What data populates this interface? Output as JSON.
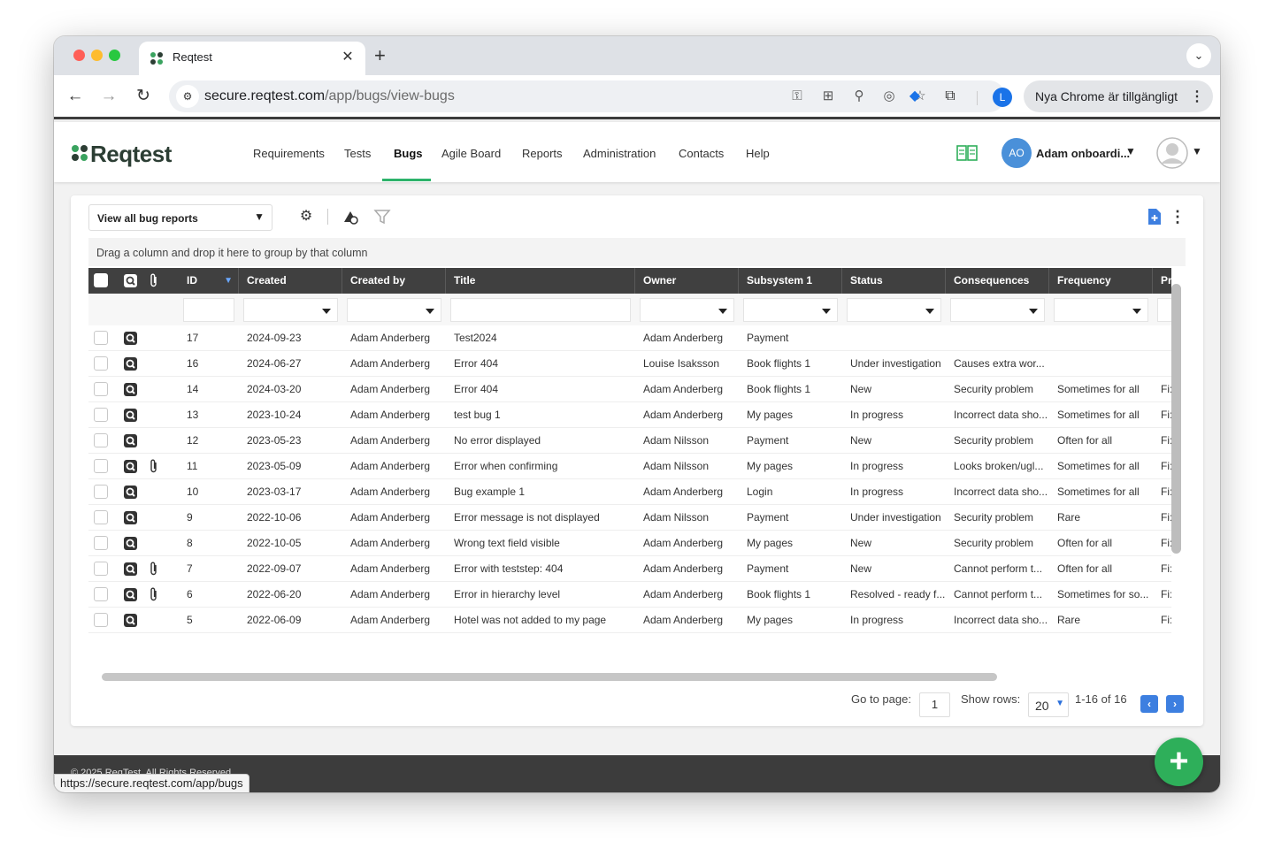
{
  "browser": {
    "tab_title": "Reqtest",
    "tab_close": "✕",
    "new_tab": "+",
    "url_host": "secure.reqtest.com",
    "url_path": "/app/bugs/view-bugs",
    "profile_initial": "L",
    "update_text": "Nya Chrome är tillgängligt"
  },
  "app": {
    "logo_text": "Reqtest",
    "nav": [
      "Requirements",
      "Tests",
      "Bugs",
      "Agile Board",
      "Reports",
      "Administration",
      "Contacts",
      "Help"
    ],
    "active_nav": "Bugs",
    "user_initials": "AO",
    "user_name": "Adam onboardi..."
  },
  "toolbar": {
    "view_select": "View all bug reports",
    "group_hint": "Drag a column and drop it here to group by that column"
  },
  "table": {
    "columns": [
      "ID",
      "Created",
      "Created by",
      "Title",
      "Owner",
      "Subsystem 1",
      "Status",
      "Consequences",
      "Frequency",
      "Pr"
    ],
    "rows": [
      {
        "attach": false,
        "id": "17",
        "created": "2024-09-23",
        "created_by": "Adam Anderberg",
        "title": "Test2024",
        "owner": "Adam Anderberg",
        "subsystem": "Payment",
        "status": "",
        "consequences": "",
        "frequency": "",
        "pr": ""
      },
      {
        "attach": false,
        "id": "16",
        "created": "2024-06-27",
        "created_by": "Adam Anderberg",
        "title": "Error 404",
        "owner": "Louise Isaksson",
        "subsystem": "Book flights 1",
        "status": "Under investigation",
        "consequences": "Causes extra wor...",
        "frequency": "",
        "pr": ""
      },
      {
        "attach": false,
        "id": "14",
        "created": "2024-03-20",
        "created_by": "Adam Anderberg",
        "title": "Error 404",
        "owner": "Adam Anderberg",
        "subsystem": "Book flights 1",
        "status": "New",
        "consequences": "Security problem",
        "frequency": "Sometimes for all",
        "pr": "Fi:"
      },
      {
        "attach": false,
        "id": "13",
        "created": "2023-10-24",
        "created_by": "Adam Anderberg",
        "title": "test bug 1",
        "owner": "Adam Anderberg",
        "subsystem": "My pages",
        "status": "In progress",
        "consequences": "Incorrect data sho...",
        "frequency": "Sometimes for all",
        "pr": "Fi:"
      },
      {
        "attach": false,
        "id": "12",
        "created": "2023-05-23",
        "created_by": "Adam Anderberg",
        "title": "No error displayed",
        "owner": "Adam Nilsson",
        "subsystem": "Payment",
        "status": "New",
        "consequences": "Security problem",
        "frequency": "Often for all",
        "pr": "Fi:"
      },
      {
        "attach": true,
        "id": "11",
        "created": "2023-05-09",
        "created_by": "Adam Anderberg",
        "title": "Error when confirming",
        "owner": "Adam Nilsson",
        "subsystem": "My pages",
        "status": "In progress",
        "consequences": "Looks broken/ugl...",
        "frequency": "Sometimes for all",
        "pr": "Fi:"
      },
      {
        "attach": false,
        "id": "10",
        "created": "2023-03-17",
        "created_by": "Adam Anderberg",
        "title": "Bug example 1",
        "owner": "Adam Anderberg",
        "subsystem": "Login",
        "status": "In progress",
        "consequences": "Incorrect data sho...",
        "frequency": "Sometimes for all",
        "pr": "Fi:"
      },
      {
        "attach": false,
        "id": "9",
        "created": "2022-10-06",
        "created_by": "Adam Anderberg",
        "title": "Error message is not displayed",
        "owner": "Adam Nilsson",
        "subsystem": "Payment",
        "status": "Under investigation",
        "consequences": "Security problem",
        "frequency": "Rare",
        "pr": "Fi:"
      },
      {
        "attach": false,
        "id": "8",
        "created": "2022-10-05",
        "created_by": "Adam Anderberg",
        "title": "Wrong text field visible",
        "owner": "Adam Anderberg",
        "subsystem": "My pages",
        "status": "New",
        "consequences": "Security problem",
        "frequency": "Often for all",
        "pr": "Fi:"
      },
      {
        "attach": true,
        "id": "7",
        "created": "2022-09-07",
        "created_by": "Adam Anderberg",
        "title": "Error with teststep: 404",
        "owner": "Adam Anderberg",
        "subsystem": "Payment",
        "status": "New",
        "consequences": "Cannot perform t...",
        "frequency": "Often for all",
        "pr": "Fi:"
      },
      {
        "attach": true,
        "id": "6",
        "created": "2022-06-20",
        "created_by": "Adam Anderberg",
        "title": "Error in hierarchy level",
        "owner": "Adam Anderberg",
        "subsystem": "Book flights 1",
        "status": "Resolved - ready f...",
        "consequences": "Cannot perform t...",
        "frequency": "Sometimes for so...",
        "pr": "Fi:"
      },
      {
        "attach": false,
        "id": "5",
        "created": "2022-06-09",
        "created_by": "Adam Anderberg",
        "title": "Hotel was not added to my page",
        "owner": "Adam Anderberg",
        "subsystem": "My pages",
        "status": "In progress",
        "consequences": "Incorrect data sho...",
        "frequency": "Rare",
        "pr": "Fi:"
      }
    ]
  },
  "pager": {
    "goto_label": "Go to page:",
    "page": "1",
    "show_rows_label": "Show rows:",
    "rows": "20",
    "range": "1-16 of 16"
  },
  "footer": {
    "copyright": "© 2025 ReqTest. All Rights Reserved"
  },
  "status_bar": {
    "url": "https://secure.reqtest.com/app/bugs"
  },
  "colors": {
    "brand_green": "#2eaf5a",
    "header_dark": "#404040",
    "accent_blue": "#3d7fe0"
  }
}
